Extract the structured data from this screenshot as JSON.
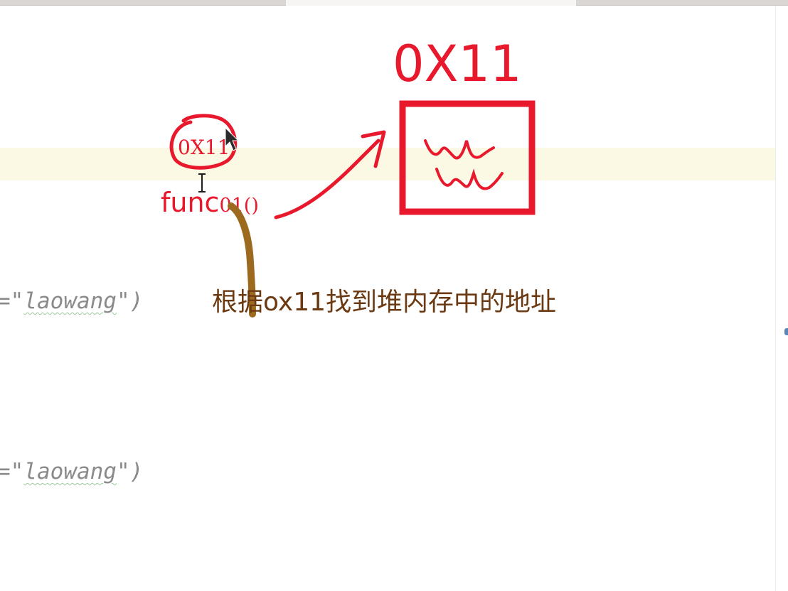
{
  "tabs": {
    "left": "",
    "active": "",
    "right": ""
  },
  "editor": {
    "code_lines": [
      {
        "prefix": "=\"",
        "string": "laowang",
        "suffix": "\")"
      },
      {
        "prefix": "=\"",
        "string": "laowang",
        "suffix": "\")"
      }
    ]
  },
  "annotation": {
    "address_small": "0X11",
    "function_call_name": "func",
    "function_call_suffix": "01()",
    "address_large": "0X11",
    "caption": "根据ox11找到堆内存中的地址",
    "colors": {
      "ink_red": "#e8192c",
      "ink_brown": "#9c6a1e",
      "caption_text": "#6b3a12",
      "current_line_bg": "#fbf8e3"
    }
  },
  "icons": {
    "cursor": "mouse-pointer-icon",
    "text_cursor": "i-beam-cursor-icon"
  }
}
